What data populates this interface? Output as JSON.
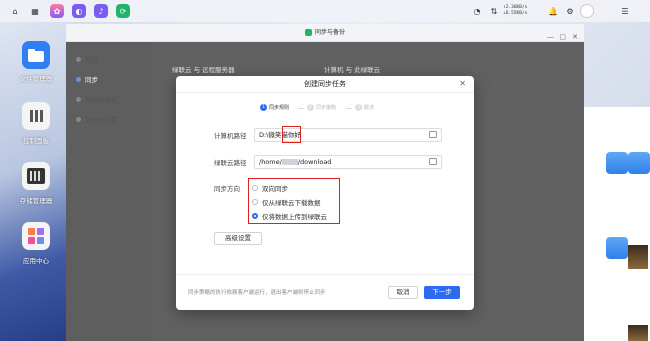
{
  "taskbar": {
    "net_up": "2.36KB/s",
    "net_down": "6.55KB/s"
  },
  "desktop": {
    "icons": [
      {
        "label": "文件管理器"
      },
      {
        "label": "控制面板"
      },
      {
        "label": "存储管理器"
      },
      {
        "label": "应用中心"
      }
    ]
  },
  "app_window": {
    "title": "同步与备份",
    "sidebar": [
      "总览",
      "同步",
      "备份与还原",
      "管理员设置"
    ],
    "headings": [
      "绿联云 与 远程服务器",
      "计算机 与 此绿联云"
    ]
  },
  "dialog": {
    "title": "创建同步任务",
    "steps": [
      "同步规则",
      "同步策略",
      "概述"
    ],
    "computer_path_label": "计算机路径",
    "computer_path_prefix": "D:\\微笑猫",
    "computer_path_highlight": "你好",
    "nas_path_label": "绿联云路径",
    "nas_path_prefix": "/home/",
    "nas_path_suffix": "/download",
    "sync_direction_label": "同步方向",
    "options": [
      "双向同步",
      "仅从绿联云下载数据",
      "仅将数据上传到绿联云"
    ],
    "selected_option": 2,
    "advanced_button": "高级设置",
    "footer_note": "同步策略的执行依赖客户端运行，退出客户端则停止同步",
    "cancel_button": "取消",
    "next_button": "下一步"
  }
}
